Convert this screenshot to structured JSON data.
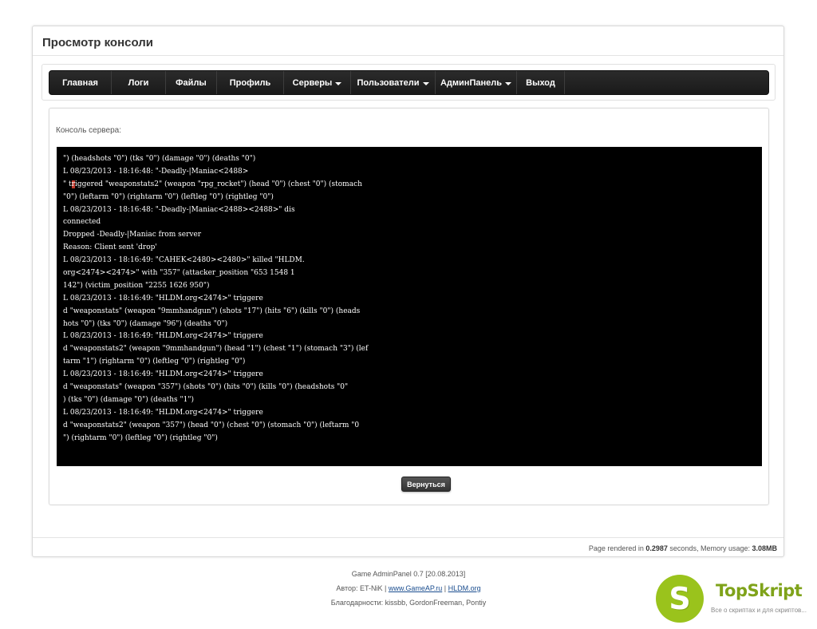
{
  "page": {
    "title": "Просмотр консоли"
  },
  "nav": {
    "items": [
      {
        "label": "Главная",
        "dropdown": false
      },
      {
        "label": "Логи",
        "dropdown": false
      },
      {
        "label": "Файлы",
        "dropdown": false
      },
      {
        "label": "Профиль",
        "dropdown": false
      },
      {
        "label": "Серверы",
        "dropdown": true
      },
      {
        "label": "Пользователи",
        "dropdown": true
      },
      {
        "label": "АдминПанель",
        "dropdown": true
      },
      {
        "label": "Выход",
        "dropdown": false
      }
    ]
  },
  "console": {
    "label": "Консоль сервера:",
    "lines": [
      "\") (headshots \"0\") (tks \"0\") (damage \"0\") (deaths \"0\")",
      "L 08/23/2013 - 18:16:48: \"-Deadly-|Maniac<2488>",
      "\" triggered \"weaponstats2\" (weapon \"rpg_rocket\") (head \"0\") (chest \"0\") (stomach",
      "\"0\") (leftarm \"0\") (rightarm \"0\") (leftleg \"0\") (rightleg \"0\")",
      "L 08/23/2013 - 18:16:48: \"-Deadly-|Maniac<2488><2488>\" dis",
      "connected",
      "Dropped -Deadly-|Maniac from server",
      "Reason: Client sent 'drop'",
      "L 08/23/2013 - 18:16:49: \"CAHEK<2480><2480>\" killed \"HLDM.",
      "org<2474><2474>\" with \"357\" (attacker_position \"653 1548 1",
      "142\") (victim_position \"2255 1626 950\")",
      "L 08/23/2013 - 18:16:49: \"HLDM.org<2474>\" triggere",
      "d \"weaponstats\" (weapon \"9mmhandgun\") (shots \"17\") (hits \"6\") (kills \"0\") (heads",
      "hots \"0\") (tks \"0\") (damage \"96\") (deaths \"0\")",
      "L 08/23/2013 - 18:16:49: \"HLDM.org<2474>\" triggere",
      "d \"weaponstats2\" (weapon \"9mmhandgun\") (head \"1\") (chest \"1\") (stomach \"3\") (lef",
      "tarm \"1\") (rightarm \"0\") (leftleg \"0\") (rightleg \"0\")",
      "L 08/23/2013 - 18:16:49: \"HLDM.org<2474>\" triggere",
      "d \"weaponstats\" (weapon \"357\") (shots \"0\") (hits \"0\") (kills \"0\") (headshots \"0\"",
      ") (tks \"0\") (damage \"0\") (deaths \"1\")",
      "L 08/23/2013 - 18:16:49: \"HLDM.org<2474>\" triggere",
      "d \"weaponstats2\" (weapon \"357\") (head \"0\") (chest \"0\") (stomach \"0\") (leftarm \"0",
      "\") (rightarm \"0\") (leftleg \"0\") (rightleg \"0\")"
    ]
  },
  "actions": {
    "back_label": "Вернуться"
  },
  "status": {
    "prefix": "Page rendered in ",
    "seconds": "0.2987",
    "middle": " seconds, Memory usage: ",
    "memory": "3.08MB"
  },
  "footer": {
    "line1": "Game AdminPanel 0.7 [20.08.2013]",
    "author_prefix": "Автор: ET-NiK | ",
    "link1": "www.GameAP.ru",
    "separator": " | ",
    "link2": "HLDM.org",
    "thanks": "Благодарности: kissbb, GordonFreeman, Pontiy"
  },
  "logo": {
    "letter": "S",
    "name": "TopSkript",
    "tagline": "Все о скриптах и для скриптов...",
    "color": "#9ac31c"
  }
}
